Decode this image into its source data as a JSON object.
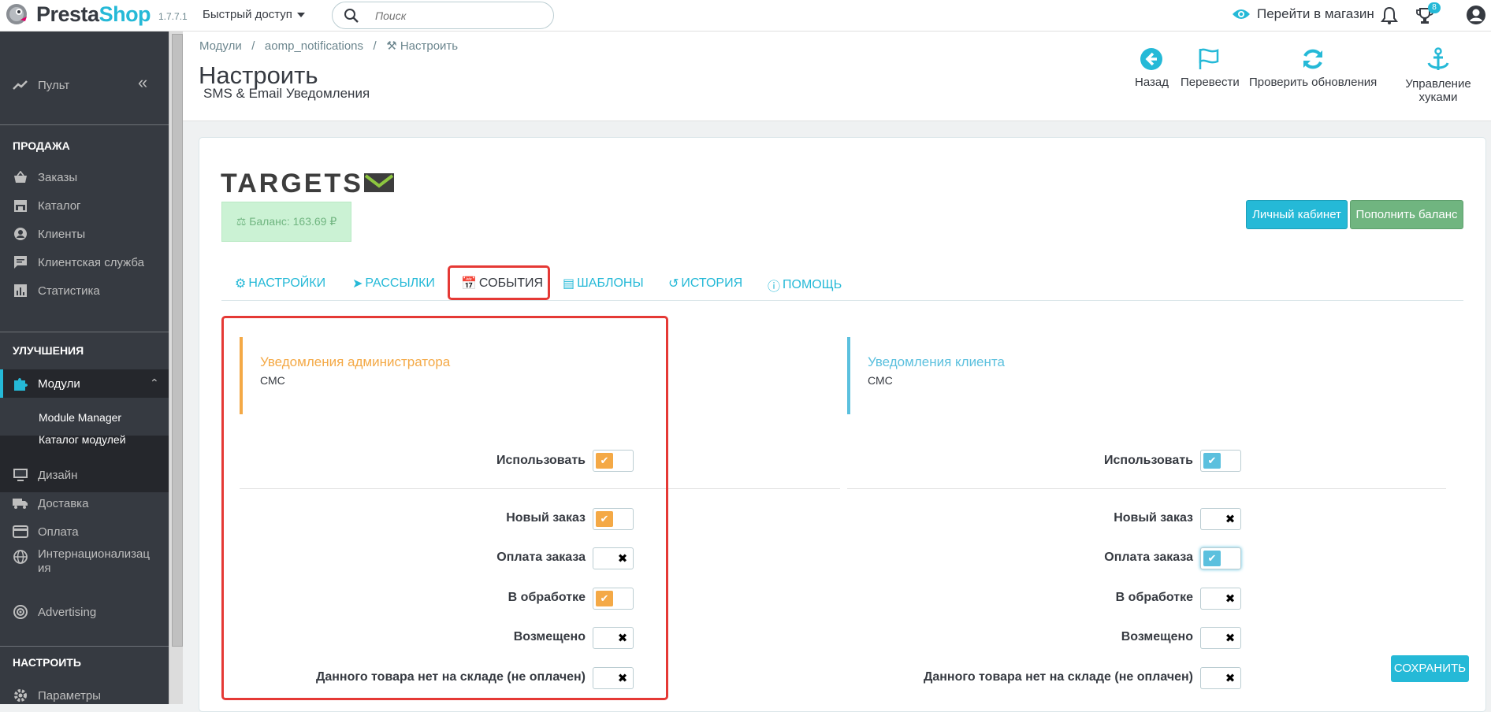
{
  "topbar": {
    "logo_part1": "Presta",
    "logo_part2": "Shop",
    "version": "1.7.7.1",
    "quick_access": "Быстрый доступ",
    "search_placeholder": "Поиск",
    "goto_shop": "Перейти в магазин",
    "notification_count": "8"
  },
  "sidebar": {
    "dashboard": "Пульт",
    "sell_heading": "ПРОДАЖА",
    "orders": "Заказы",
    "catalog": "Каталог",
    "customers": "Клиенты",
    "customer_service": "Клиентская служба",
    "stats": "Статистика",
    "improve_heading": "УЛУЧШЕНИЯ",
    "modules": "Модули",
    "module_manager": "Module Manager",
    "module_catalog": "Каталог модулей",
    "design": "Дизайн",
    "shipping": "Доставка",
    "payment": "Оплата",
    "international": "Интернационализац\nия",
    "advertising": "Advertising",
    "configure_heading": "НАСТРОИТЬ",
    "params": "Параметры"
  },
  "header": {
    "breadcrumb": [
      "Модули",
      "aomp_notifications",
      "Настроить"
    ],
    "title": "Настроить",
    "subtitle": "SMS & Email Уведомления",
    "toolbar": {
      "back": "Назад",
      "translate": "Перевести",
      "check_updates": "Проверить обновления",
      "manage_hooks": "Управление хуками"
    }
  },
  "module": {
    "brand": "TARGETSMS",
    "balance": "Баланс: 163.69 ₽",
    "cabinet_button": "Личный кабинет",
    "topup_button": "Пополнить баланс",
    "tabs": [
      "НАСТРОЙКИ",
      "РАССЫЛКИ",
      "СОБЫТИЯ",
      "ШАБЛОНЫ",
      "ИСТОРИЯ",
      "ПОМОЩЬ"
    ],
    "active_tab": "СОБЫТИЯ",
    "admin_panel": {
      "title": "Уведомления администратора",
      "subtitle": "СМС",
      "color": "#f4a946",
      "rows": [
        {
          "label": "Использовать",
          "enabled": true
        },
        {
          "label": "Новый заказ",
          "enabled": true
        },
        {
          "label": "Оплата заказа",
          "enabled": false
        },
        {
          "label": "В обработке",
          "enabled": true
        },
        {
          "label": "Возмещено",
          "enabled": false
        },
        {
          "label": "Данного товара нет на складе (не оплачен)",
          "enabled": false
        }
      ]
    },
    "client_panel": {
      "title": "Уведомления клиента",
      "subtitle": "СМС",
      "color": "#5bc0de",
      "rows": [
        {
          "label": "Использовать",
          "enabled": true
        },
        {
          "label": "Новый заказ",
          "enabled": false
        },
        {
          "label": "Оплата заказа",
          "enabled": true
        },
        {
          "label": "В обработке",
          "enabled": false
        },
        {
          "label": "Возмещено",
          "enabled": false
        },
        {
          "label": "Данного товара нет на складе (не оплачен)",
          "enabled": false
        }
      ]
    },
    "save_button": "СОХРАНИТЬ"
  },
  "colors": {
    "accent": "#25b9d7",
    "sidebar": "#363a41",
    "highlight": "#e53935"
  }
}
